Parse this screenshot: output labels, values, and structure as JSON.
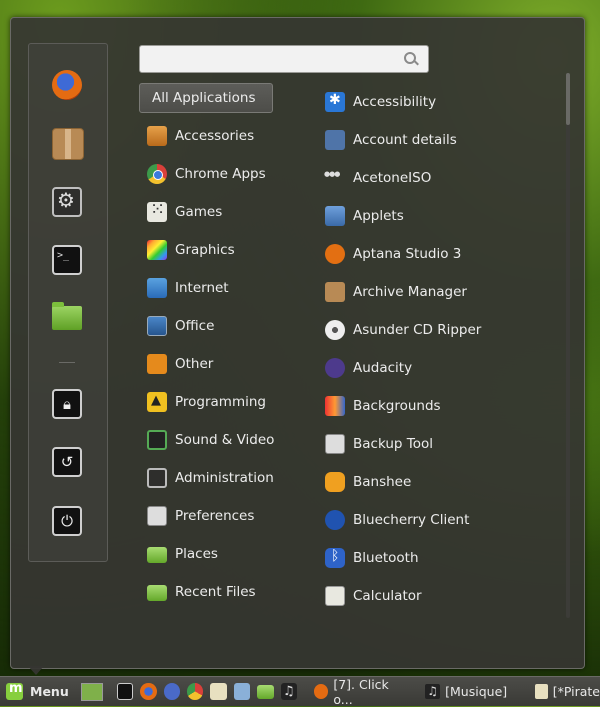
{
  "search": {
    "placeholder": ""
  },
  "favorites": [
    {
      "name": "firefox-icon"
    },
    {
      "name": "package-icon"
    },
    {
      "name": "settings-icon"
    },
    {
      "name": "terminal-icon"
    },
    {
      "name": "folder-icon"
    },
    {
      "name": "lock-icon"
    },
    {
      "name": "logout-icon"
    },
    {
      "name": "power-icon"
    }
  ],
  "categories": [
    {
      "label": "All Applications",
      "icon": "all-apps"
    },
    {
      "label": "Accessories",
      "icon": "accessories-icon"
    },
    {
      "label": "Chrome Apps",
      "icon": "chrome-icon"
    },
    {
      "label": "Games",
      "icon": "games-icon"
    },
    {
      "label": "Graphics",
      "icon": "graphics-icon"
    },
    {
      "label": "Internet",
      "icon": "internet-icon"
    },
    {
      "label": "Office",
      "icon": "office-icon"
    },
    {
      "label": "Other",
      "icon": "other-icon"
    },
    {
      "label": "Programming",
      "icon": "programming-icon"
    },
    {
      "label": "Sound & Video",
      "icon": "sound-video-icon"
    },
    {
      "label": "Administration",
      "icon": "administration-icon"
    },
    {
      "label": "Preferences",
      "icon": "preferences-icon"
    },
    {
      "label": "Places",
      "icon": "places-folder-icon"
    },
    {
      "label": "Recent Files",
      "icon": "recent-files-icon"
    }
  ],
  "apps": [
    {
      "label": "Accessibility"
    },
    {
      "label": "Account details"
    },
    {
      "label": "AcetoneISO"
    },
    {
      "label": "Applets"
    },
    {
      "label": "Aptana Studio 3"
    },
    {
      "label": "Archive Manager"
    },
    {
      "label": "Asunder CD Ripper"
    },
    {
      "label": "Audacity"
    },
    {
      "label": "Backgrounds"
    },
    {
      "label": "Backup Tool"
    },
    {
      "label": "Banshee"
    },
    {
      "label": "Bluecherry Client"
    },
    {
      "label": "Bluetooth"
    },
    {
      "label": "Calculator"
    }
  ],
  "taskbar": {
    "menu_label": "Menu",
    "tasks": [
      {
        "label": "[7]. Click o..."
      },
      {
        "label": "[Musique]"
      },
      {
        "label": "[*Pirate"
      }
    ]
  }
}
